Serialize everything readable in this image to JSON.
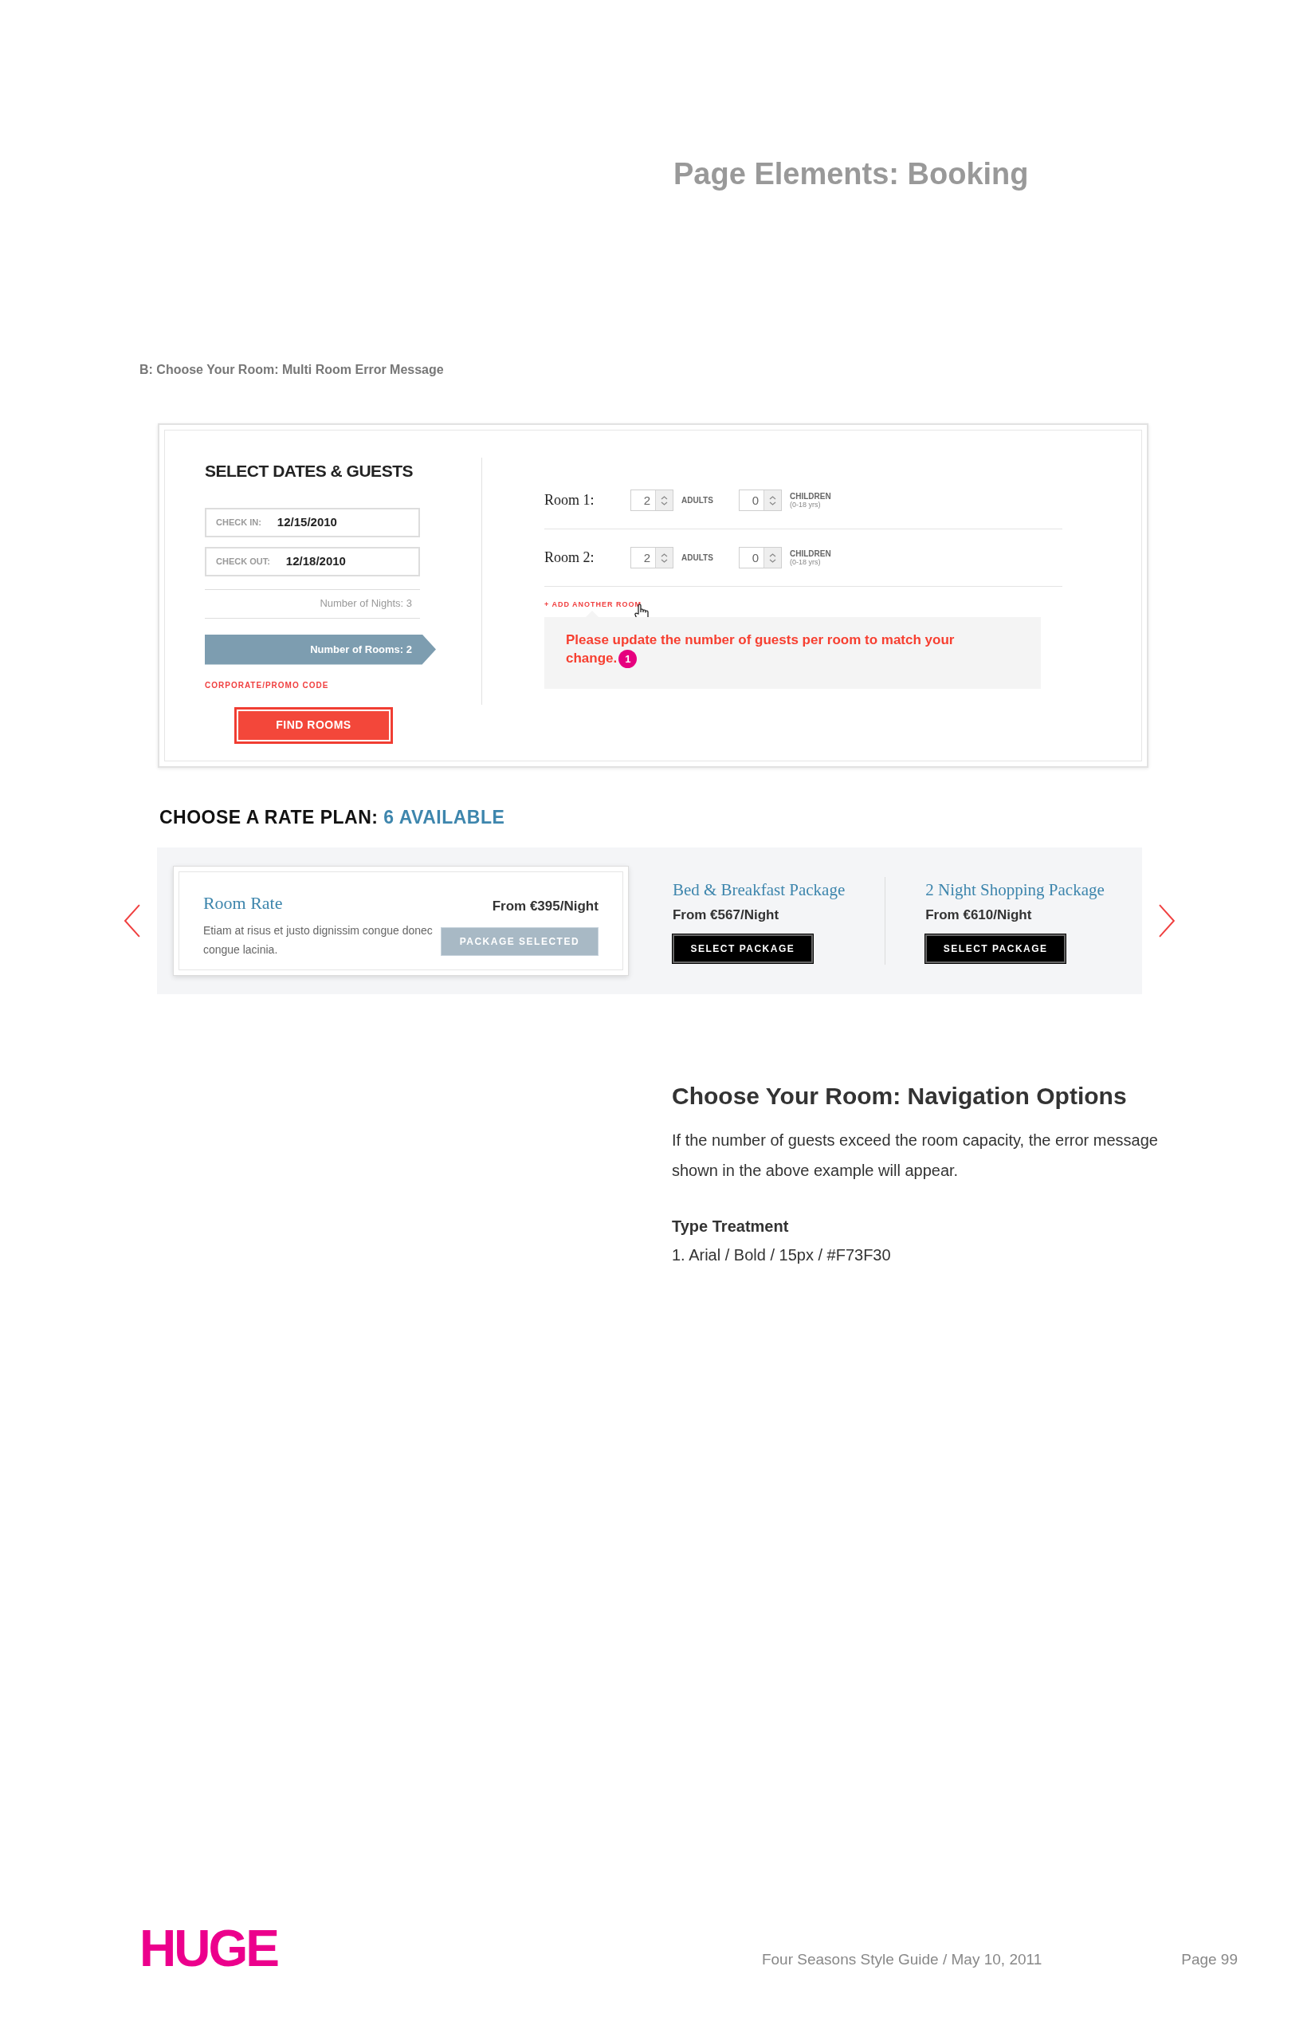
{
  "page_title": "Page Elements: Booking",
  "section_caption": "B: Choose Your Room: Multi Room Error Message",
  "booking_widget": {
    "heading": "SELECT DATES & GUESTS",
    "check_in": {
      "label": "CHECK IN:",
      "value": "12/15/2010"
    },
    "check_out": {
      "label": "CHECK OUT:",
      "value": "12/18/2010"
    },
    "nights": "Number of Nights: 3",
    "rooms_count": "Number of Rooms: 2",
    "promo_link": "CORPORATE/PROMO CODE",
    "find_button": "FIND ROOMS",
    "rooms": [
      {
        "label": "Room 1:",
        "adults": "2",
        "adults_label": "ADULTS",
        "children": "0",
        "children_label": "CHILDREN",
        "children_note": "(0-18 yrs)"
      },
      {
        "label": "Room 2:",
        "adults": "2",
        "adults_label": "ADULTS",
        "children": "0",
        "children_label": "CHILDREN",
        "children_note": "(0-18 yrs)"
      }
    ],
    "add_room_link": "+ ADD ANOTHER ROOM",
    "error": {
      "message": "Please update the number of guests per room to match your change.",
      "marker": "1"
    }
  },
  "rate_plan": {
    "heading": "CHOOSE A RATE PLAN:",
    "count": "6 AVAILABLE",
    "plans": [
      {
        "name": "Room Rate",
        "description": "Etiam at risus et justo dignissim congue donec congue lacinia.",
        "price": "From €395/Night",
        "button": "PACKAGE SELECTED",
        "selected": true
      },
      {
        "name": "Bed & Breakfast Package",
        "price": "From €567/Night",
        "button": "SELECT PACKAGE",
        "selected": false
      },
      {
        "name": "2 Night Shopping Package",
        "price": "From €610/Night",
        "button": "SELECT PACKAGE",
        "selected": false
      }
    ]
  },
  "notes": {
    "heading": "Choose Your Room: Navigation Options",
    "body": "If the number of guests exceed the room capacity, the error message shown in the above example will appear.",
    "type_heading": "Type Treatment",
    "type_items": [
      "1. Arial / Bold / 15px / #F73F30"
    ]
  },
  "footer": {
    "logo": "HUGE",
    "document": "Four Seasons Style Guide / May 10, 2011",
    "page": "Page 99"
  }
}
